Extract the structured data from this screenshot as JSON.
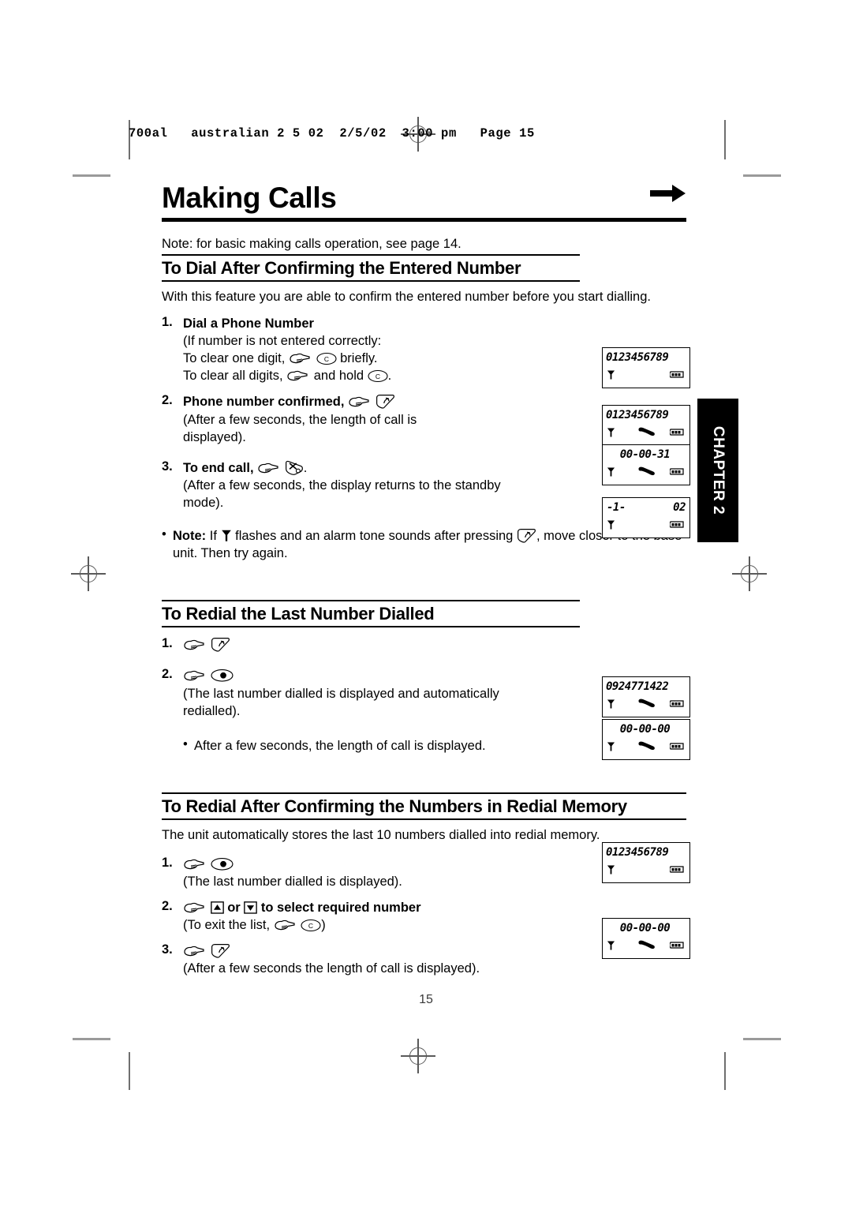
{
  "printer_slug": "700al   australian 2 5 02  2/5/02  3:00 pm   Page 15",
  "title": "Making Calls",
  "title_arrow_icon": "right-arrow-icon",
  "intro_note": "Note: for basic making calls operation, see page 14.",
  "chapter_tab": "CHAPTER 2",
  "folio": "15",
  "sections": [
    {
      "heading": "To Dial After Confirming the Entered Number",
      "intro": "With this feature you are able to confirm the entered number before you start dialling.",
      "steps": [
        {
          "num": "1.",
          "bold_label": "Dial a Phone Number",
          "lines": [
            "(If number is not entered correctly:",
            "To clear one digit, [hand] [C] briefly.",
            "To clear all digits, [hand] and hold [C] ."
          ]
        },
        {
          "num": "2.",
          "bold_label": "Phone number confirmed,",
          "lines": [
            "(After a few seconds, the length of call is",
            "displayed)."
          ]
        },
        {
          "num": "3.",
          "bold_label": "To end call,",
          "lines": [
            "(After a few seconds, the display returns to the standby",
            "mode)."
          ]
        }
      ],
      "note_bullet": {
        "label": "Note:",
        "text_before": "If",
        "text_middle": "flashes and an alarm tone sounds after pressing",
        "text_after": ", move closer to the base unit. Then try again."
      }
    },
    {
      "heading": "To Redial the Last Number Dialled",
      "steps": [
        {
          "num": "1.",
          "lines": []
        },
        {
          "num": "2.",
          "lines": [
            "(The last number dialled is displayed and automatically",
            "redialled)."
          ]
        }
      ],
      "bullet": "After a few seconds, the length of call is displayed."
    },
    {
      "heading": "To Redial After Confirming the Numbers in Redial Memory",
      "intro": "The unit automatically stores the last 10 numbers dialled into redial memory.",
      "steps": [
        {
          "num": "1.",
          "lines": [
            "(The last number dialled is displayed)."
          ]
        },
        {
          "num": "2.",
          "bold_mid": "or",
          "bold_tail": "to select required number",
          "lines": [
            "(To exit the list, [hand] [C] )"
          ]
        },
        {
          "num": "3.",
          "lines": [
            "(After a few seconds the length of call is displayed)."
          ]
        }
      ]
    }
  ],
  "inline_text": {
    "clear_one_prefix": "To clear one digit,",
    "clear_one_suffix": "briefly.",
    "clear_all_prefix": "To clear all digits,",
    "clear_all_mid": "and hold",
    "clear_all_suffix": ".",
    "if_number_line": "(If number is not entered correctly:",
    "exit_list_prefix": "(To exit the list,",
    "exit_list_suffix": ")",
    "or_word": "or"
  },
  "lcd_displays": [
    {
      "id": "lcd-1",
      "text": "0123456789",
      "align": "left",
      "icons": [
        "antenna",
        "battery"
      ]
    },
    {
      "id": "lcd-2",
      "text": "0123456789",
      "align": "left",
      "icons": [
        "antenna",
        "handset",
        "battery"
      ]
    },
    {
      "id": "lcd-3",
      "text": "00-00-31",
      "align": "center",
      "icons": [
        "antenna",
        "handset",
        "battery"
      ]
    },
    {
      "id": "lcd-4",
      "left_text": "-1-",
      "right_text": "02",
      "icons": [
        "antenna",
        "battery"
      ]
    },
    {
      "id": "lcd-5",
      "text": "0924771422",
      "align": "left",
      "icons": [
        "antenna",
        "handset",
        "battery"
      ]
    },
    {
      "id": "lcd-6",
      "text": "00-00-00",
      "align": "center",
      "icons": [
        "antenna",
        "handset",
        "battery"
      ]
    },
    {
      "id": "lcd-7",
      "text": "0123456789",
      "align": "left",
      "icons": [
        "antenna",
        "battery"
      ]
    },
    {
      "id": "lcd-8",
      "text": "00-00-00",
      "align": "center",
      "icons": [
        "antenna",
        "handset",
        "battery"
      ]
    }
  ]
}
